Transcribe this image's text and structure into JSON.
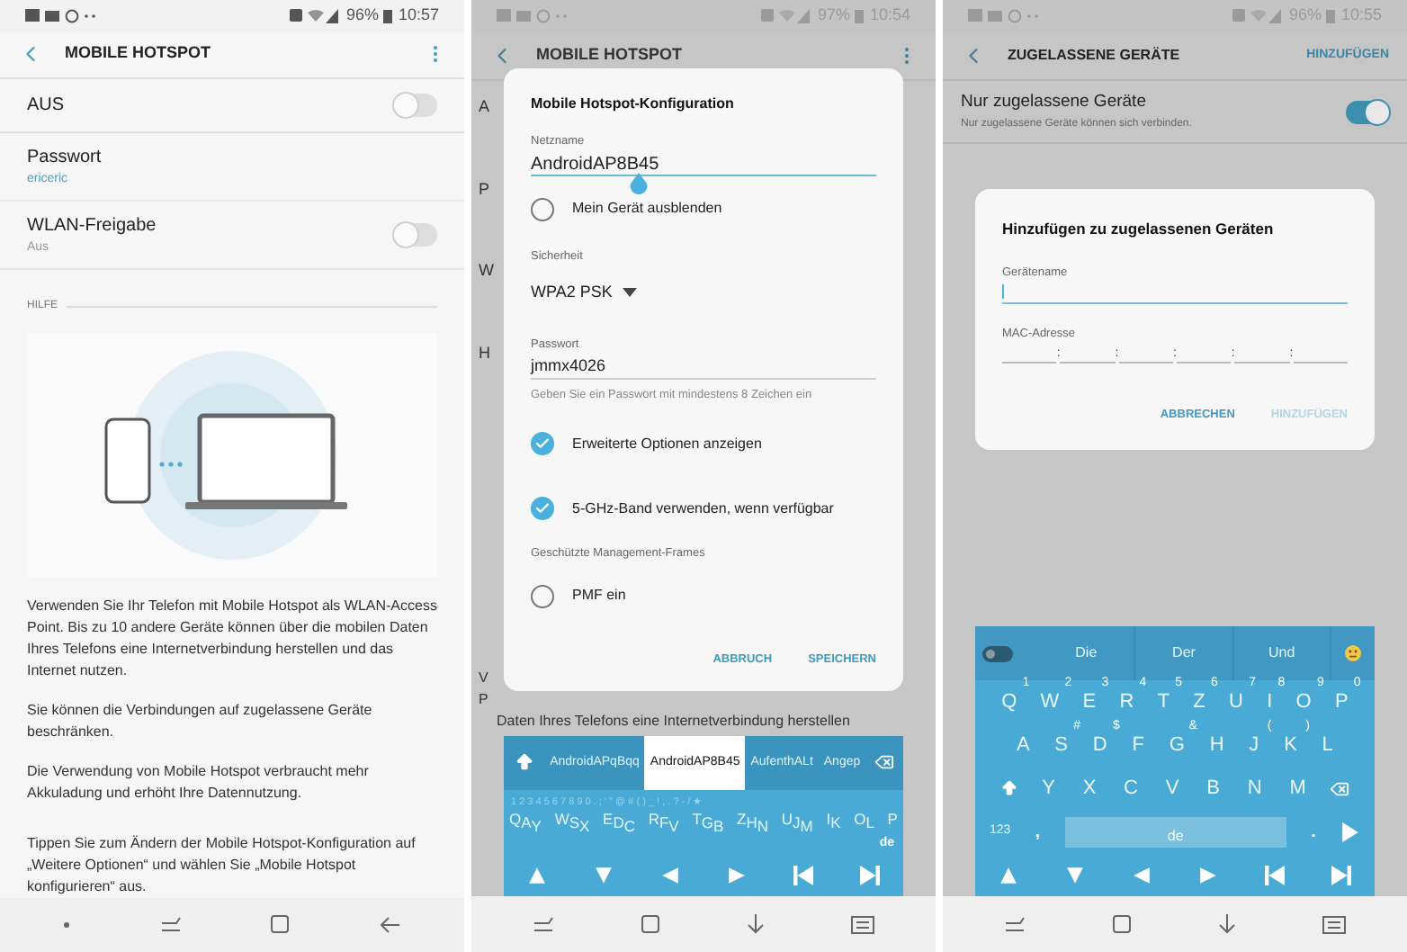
{
  "hotspot_screen": {
    "status_bar": {
      "battery": "96%",
      "time": "10:57"
    },
    "title": "MOBILE HOTSPOT",
    "settings": [
      {
        "kind": "switch",
        "label": "AUS",
        "on": false
      },
      {
        "kind": "value",
        "label": "Passwort",
        "value": "ericeric"
      },
      {
        "kind": "switch",
        "label": "WLAN-Freigabe",
        "sublabel": "Aus",
        "on": false
      }
    ],
    "help_header": "HILFE",
    "help_paragraphs": [
      "Verwenden Sie Ihr Telefon mit Mobile Hotspot als WLAN-Access Point. Bis zu 10 andere Geräte können über die mobilen Daten Ihres Telefons eine Internetverbindung herstellen und das Internet nutzen.",
      "Sie können die Verbindungen auf zugelassene Geräte beschränken.",
      "Die Verwendung von Mobile Hotspot verbraucht mehr Akkuladung und erhöht Ihre Datennutzung.",
      "Tippen Sie zum Ändern der Mobile Hotspot-Konfiguration auf „Weitere Optionen“ und wählen Sie „Mobile Hotspot konfigurieren“ aus."
    ]
  },
  "config_screen": {
    "status_bar": {
      "battery": "97%",
      "time": "10:54"
    },
    "background_title": "MOBILE HOTSPOT",
    "background_fragments": [
      "A",
      "P",
      "W",
      "H"
    ],
    "background_bottom_fragments": [
      "V",
      "P"
    ],
    "background_line": "Daten Ihres Telefons eine Internetverbindung herstellen",
    "dialog": {
      "title": "Mobile Hotspot-Konfiguration",
      "network_name": {
        "label": "Netzname",
        "value": "AndroidAP8B45"
      },
      "hide_device": {
        "label": "Mein Gerät ausblenden",
        "checked": false
      },
      "security": {
        "label": "Sicherheit",
        "value": "WPA2 PSK"
      },
      "password": {
        "label": "Passwort",
        "value": "jmmx4026",
        "hint": "Geben Sie ein Passwort mit mindestens 8 Zeichen ein"
      },
      "options": [
        {
          "label": "Erweiterte Optionen anzeigen",
          "checked": true
        },
        {
          "label": "5-GHz-Band verwenden, wenn verfügbar",
          "checked": true
        }
      ],
      "pmf_header": "Geschützte Management-Frames",
      "pmf": {
        "label": "PMF ein",
        "checked": false
      },
      "buttons": [
        "ABBRUCH",
        "SPEICHERN"
      ]
    },
    "keyboard": {
      "suggestions": [
        {
          "text": "AndroidAPqBqq",
          "selected": false
        },
        {
          "text": "AndroidAP8B45",
          "selected": true
        },
        {
          "text": "AufenthALt",
          "selected": false
        },
        {
          "text": "Angep",
          "selected": false
        }
      ],
      "symbol_hints": "1 2 3 4 5 6 7 8 9 0 . ; ' \" @ # ( ) _ ! , . ? - / ★",
      "letter_columns": [
        [
          "Q",
          "A",
          "Y"
        ],
        [
          "W",
          "S",
          "X"
        ],
        [
          "E",
          "D",
          "C"
        ],
        [
          "R",
          "F",
          "V"
        ],
        [
          "T",
          "G",
          "B"
        ],
        [
          "Z",
          "H",
          "N"
        ],
        [
          "U",
          "J",
          "M"
        ],
        [
          "I",
          "K"
        ],
        [
          "O",
          "L"
        ],
        [
          "P"
        ]
      ],
      "language": "de"
    }
  },
  "allowed_screen": {
    "status_bar": {
      "battery": "96%",
      "time": "10:55"
    },
    "title": "ZUGELASSENE GERÄTE",
    "action": "HINZUFÜGEN",
    "setting": {
      "label": "Nur zugelassene Geräte",
      "sublabel": "Nur zugelassene Geräte können sich verbinden.",
      "on": true
    },
    "dialog": {
      "title": "Hinzufügen zu zugelassenen Geräten",
      "name_label": "Gerätename",
      "mac_label": "MAC-Adresse",
      "mac_separators": [
        ":",
        ":",
        ":",
        ":",
        ":"
      ],
      "buttons": [
        {
          "label": "ABBRECHEN",
          "disabled": false
        },
        {
          "label": "HINZUFÜGEN",
          "disabled": true
        }
      ]
    },
    "keyboard": {
      "suggestions": [
        "Die",
        "Der",
        "Und"
      ],
      "top_row": [
        {
          "label": "Q",
          "hint": "1"
        },
        {
          "label": "W",
          "hint": "2"
        },
        {
          "label": "E",
          "hint": "3"
        },
        {
          "label": "R",
          "hint": "4"
        },
        {
          "label": "T",
          "hint": "5"
        },
        {
          "label": "Z",
          "hint": "6"
        },
        {
          "label": "U",
          "hint": "7"
        },
        {
          "label": "I",
          "hint": "8"
        },
        {
          "label": "O",
          "hint": "9"
        },
        {
          "label": "P",
          "hint": "0"
        }
      ],
      "middle_row": [
        {
          "label": "A"
        },
        {
          "label": "S",
          "hint": "#"
        },
        {
          "label": "D",
          "hint": "$"
        },
        {
          "label": "F"
        },
        {
          "label": "G",
          "hint": "&"
        },
        {
          "label": "H"
        },
        {
          "label": "J",
          "hint": "("
        },
        {
          "label": "K",
          "hint": ")"
        },
        {
          "label": "L"
        }
      ],
      "bottom_row": [
        {
          "label": "Y"
        },
        {
          "label": "X"
        },
        {
          "label": "C"
        },
        {
          "label": "V"
        },
        {
          "label": "B"
        },
        {
          "label": "N"
        },
        {
          "label": "M"
        }
      ],
      "numbers_key": "123",
      "comma_key": ",",
      "space_label": "de",
      "period_key": "."
    }
  }
}
